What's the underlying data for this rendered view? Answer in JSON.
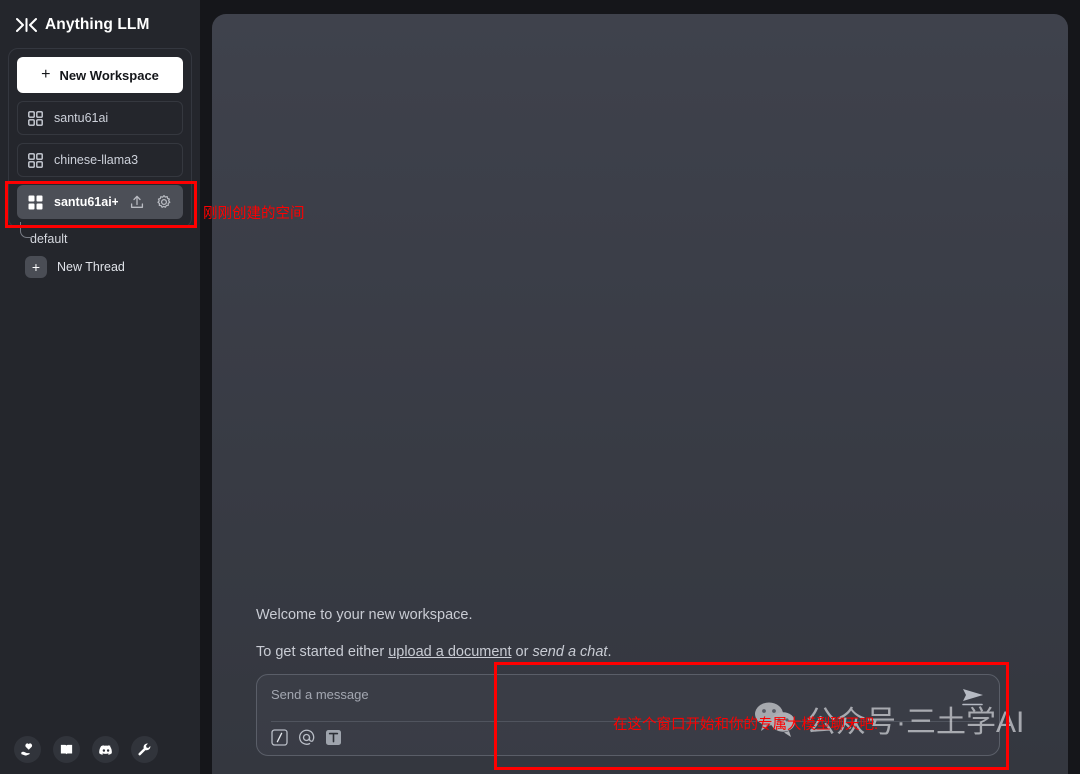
{
  "app": {
    "brand": "Anything LLM",
    "brand_mark_icon": "anythingllm-logo-icon"
  },
  "sidebar": {
    "new_workspace_label": "New Workspace",
    "new_workspace_icon": "plus-icon",
    "workspaces": [
      {
        "name": "santu61ai",
        "icon": "grid-squares-icon",
        "active": false
      },
      {
        "name": "chinese-llama3",
        "icon": "grid-squares-icon",
        "active": false
      },
      {
        "name": "santu61ai+",
        "icon": "grid-squares-filled-icon",
        "active": true
      }
    ],
    "active_workspace_actions": {
      "upload_icon": "upload-icon",
      "settings_icon": "gear-icon"
    },
    "threads": [
      {
        "name": "default"
      }
    ],
    "new_thread_label": "New Thread",
    "new_thread_icon": "plus-icon",
    "footer_icons": [
      {
        "name": "hand-heart-icon",
        "label": "Support"
      },
      {
        "name": "book-icon",
        "label": "Docs"
      },
      {
        "name": "discord-icon",
        "label": "Discord"
      },
      {
        "name": "wrench-icon",
        "label": "Settings"
      }
    ]
  },
  "main": {
    "welcome_title": "Welcome to your new workspace.",
    "getting_started_prefix": "To get started either ",
    "upload_link": "upload a document",
    "getting_started_middle": " or ",
    "chat_link": "send a chat",
    "getting_started_suffix": "."
  },
  "composer": {
    "placeholder": "Send a message",
    "send_icon": "send-paper-plane-icon",
    "tools": [
      {
        "name": "slash-command-icon",
        "glyph": "/"
      },
      {
        "name": "at-mention-icon",
        "glyph": "@"
      },
      {
        "name": "text-format-icon",
        "glyph": "T"
      }
    ]
  },
  "annotations": [
    {
      "id": "workspace",
      "text": "刚刚创建的空间",
      "color": "#fe0000"
    },
    {
      "id": "composer",
      "text": "在这个窗口开始和你的专属大模型聊天吧.",
      "color": "#fe0000"
    }
  ],
  "watermark": {
    "icon": "wechat-icon",
    "text": "公众号·三土学AI"
  },
  "colors": {
    "sidebar_bg": "#24262c",
    "main_panel_bg": "#3b3e48",
    "page_bg": "#15161a",
    "accent_red": "#fe0000",
    "active_item_bg": "#4c4f57"
  }
}
